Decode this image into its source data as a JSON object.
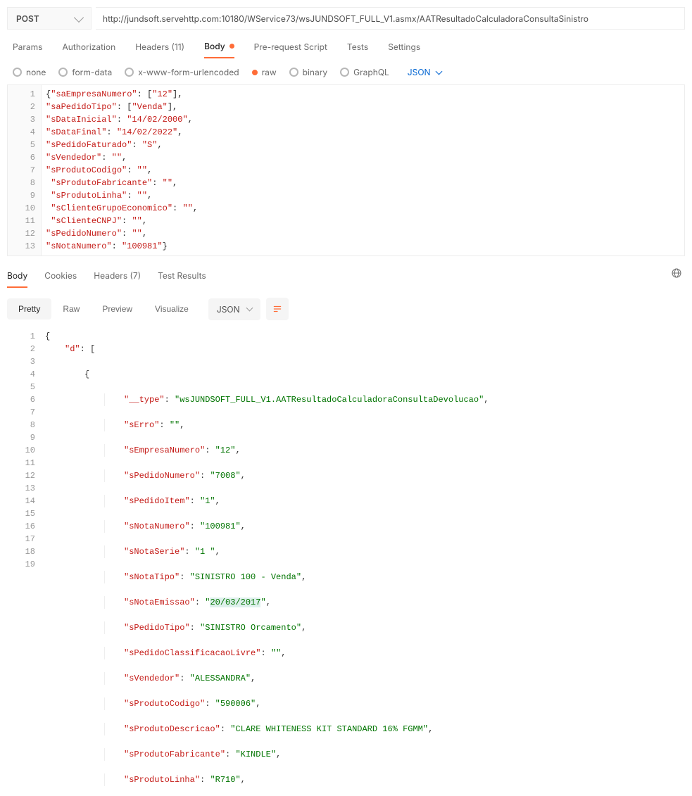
{
  "request": {
    "method": "POST",
    "url": "http://jundsoft.servehttp.com:10180/WService73/wsJUNDSOFT_FULL_V1.asmx/AATResultadoCalculadoraConsultaSinistro"
  },
  "tabs": {
    "params": "Params",
    "auth": "Authorization",
    "headers": "Headers (11)",
    "body": "Body",
    "prereq": "Pre-request Script",
    "tests": "Tests",
    "settings": "Settings"
  },
  "bodytypes": {
    "none": "none",
    "formdata": "form-data",
    "urlenc": "x-www-form-urlencoded",
    "raw": "raw",
    "binary": "binary",
    "graphql": "GraphQL",
    "dropdown": "JSON"
  },
  "response_tabs": {
    "body": "Body",
    "cookies": "Cookies",
    "headers": "Headers (7)",
    "tests": "Test Results"
  },
  "viewbar": {
    "pretty": "Pretty",
    "raw": "Raw",
    "preview": "Preview",
    "visualize": "Visualize",
    "fmt": "JSON"
  },
  "request_body": {
    "saEmpresaNumero": [
      "12"
    ],
    "saPedidoTipo": [
      "Venda"
    ],
    "sDataInicial": "14/02/2000",
    "sDataFinal": "14/02/2022",
    "sPedidoFaturado": "S",
    "sVendedor": "",
    "sProdutoCodigo": "",
    "sProdutoFabricante": "",
    "sProdutoLinha": "",
    "sClienteGrupoEconomico": "",
    "sClienteCNPJ": "",
    "sPedidoNumero": "",
    "sNotaNumero": "100981"
  },
  "response_body": {
    "d": [
      {
        "__type": "wsJUNDSOFT_FULL_V1.AATResultadoCalculadoraConsultaDevolucao",
        "sErro": "",
        "sEmpresaNumero": "12",
        "sPedidoNumero": "7008",
        "sPedidoItem": "1",
        "sNotaNumero": "100981",
        "sNotaSerie": "1 ",
        "sNotaTipo": "SINISTRO 100 - Venda",
        "sNotaEmissao": "20/03/2017",
        "sPedidoTipo": "SINISTRO Orcamento",
        "sPedidoClassificacaoLivre": "",
        "sVendedor": "ALESSANDRA",
        "sProdutoCodigo": "590006",
        "sProdutoDescricao": "CLARE WHITENESS KIT STANDARD 16% FGMM",
        "sProdutoFabricante": "KINDLE",
        "sProdutoLinha": "R710"
      }
    ]
  }
}
